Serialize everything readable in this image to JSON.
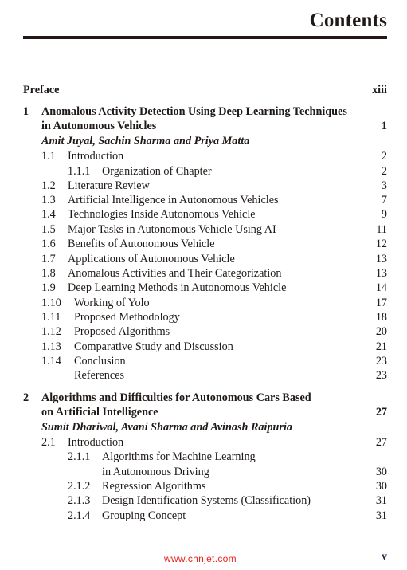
{
  "page": {
    "title": "Contents",
    "folio": "v",
    "watermark": "www.chnjet.com"
  },
  "preface": {
    "label": "Preface",
    "page": "xiii"
  },
  "chapters": [
    {
      "number": "1",
      "title_line1": "Anomalous Activity Detection Using Deep Learning Techniques",
      "title_line2": "in Autonomous Vehicles",
      "page": "1",
      "authors": "Amit Juyal, Sachin Sharma and Priya Matta",
      "sections": [
        {
          "number": "1.1",
          "title": "Introduction",
          "page": "2"
        },
        {
          "number": "1.1.1",
          "title": "Organization of Chapter",
          "page": "2"
        },
        {
          "number": "1.2",
          "title": "Literature Review",
          "page": "3"
        },
        {
          "number": "1.3",
          "title": "Artificial Intelligence in Autonomous Vehicles",
          "page": "7"
        },
        {
          "number": "1.4",
          "title": "Technologies Inside Autonomous Vehicle",
          "page": "9"
        },
        {
          "number": "1.5",
          "title": "Major Tasks in Autonomous Vehicle Using AI",
          "page": "11"
        },
        {
          "number": "1.6",
          "title": "Benefits of Autonomous Vehicle",
          "page": "12"
        },
        {
          "number": "1.7",
          "title": "Applications of Autonomous Vehicle",
          "page": "13"
        },
        {
          "number": "1.8",
          "title": "Anomalous Activities and Their Categorization",
          "page": "13"
        },
        {
          "number": "1.9",
          "title": "Deep Learning Methods in Autonomous Vehicle",
          "page": "14"
        },
        {
          "number": "1.10",
          "title": "Working of Yolo",
          "page": "17"
        },
        {
          "number": "1.11",
          "title": "Proposed Methodology",
          "page": "18"
        },
        {
          "number": "1.12",
          "title": "Proposed Algorithms",
          "page": "20"
        },
        {
          "number": "1.13",
          "title": "Comparative Study and Discussion",
          "page": "21"
        },
        {
          "number": "1.14",
          "title": "Conclusion",
          "page": "23"
        },
        {
          "number": "",
          "title": "References",
          "page": "23"
        }
      ]
    },
    {
      "number": "2",
      "title_line1": "Algorithms and Difficulties for Autonomous Cars Based",
      "title_line2": "on Artificial Intelligence",
      "page": "27",
      "authors": "Sumit Dhariwal, Avani Sharma and Avinash Raipuria",
      "sections": [
        {
          "number": "2.1",
          "title": "Introduction",
          "page": "27"
        },
        {
          "number": "2.1.1",
          "title": "Algorithms for Machine Learning",
          "title_line2": "in Autonomous Driving",
          "page": "30"
        },
        {
          "number": "2.1.2",
          "title": "Regression Algorithms",
          "page": "30"
        },
        {
          "number": "2.1.3",
          "title": "Design Identification Systems (Classification)",
          "page": "31"
        },
        {
          "number": "2.1.4",
          "title": "Grouping Concept",
          "page": "31"
        }
      ]
    }
  ]
}
